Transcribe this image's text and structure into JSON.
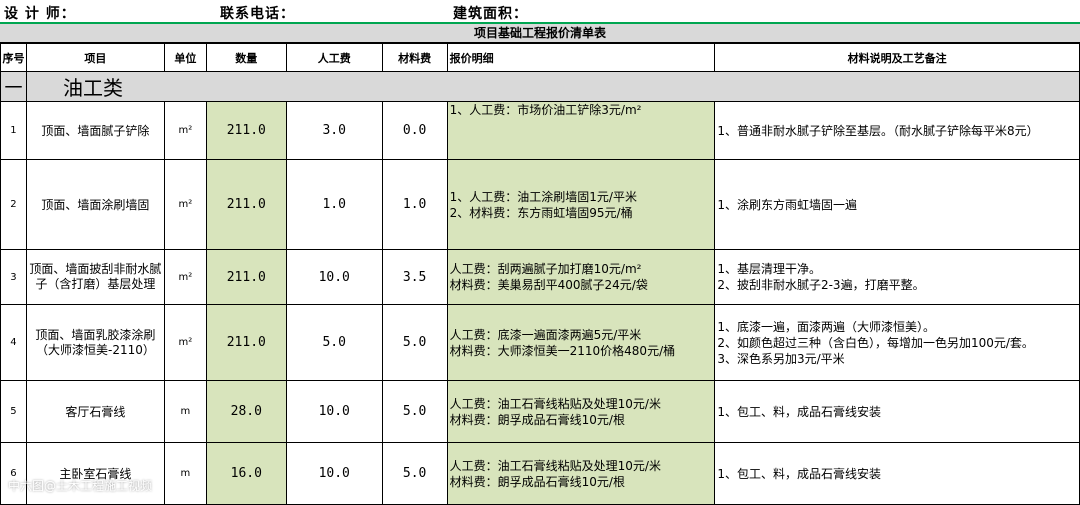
{
  "header_line": {
    "designer": "设  计  师：",
    "phone": "联系电话：",
    "area": "建筑面积："
  },
  "sheet_title": "项目基础工程报价清单表",
  "columns": [
    "序号",
    "项目",
    "单位",
    "数量",
    "人工费",
    "材料费",
    "报价明细",
    "材料说明及工艺备注"
  ],
  "section": {
    "index": "一",
    "name": "油工类"
  },
  "rows": [
    {
      "no": "1",
      "item": "顶面、墙面腻子铲除",
      "unit": "m²",
      "qty": "211.0",
      "labor": "3.0",
      "material": "0.0",
      "detail": "1、人工费：市场价油工铲除3元/m²",
      "note": "1、普通非耐水腻子铲除至基层。（耐水腻子铲除每平米8元）"
    },
    {
      "no": "2",
      "item": "顶面、墙面涂刷墙固",
      "unit": "m²",
      "qty": "211.0",
      "labor": "1.0",
      "material": "1.0",
      "detail": "1、人工费：油工涂刷墙固1元/平米\n2、材料费：东方雨虹墙固95元/桶",
      "note": "1、涂刷东方雨虹墙固一遍"
    },
    {
      "no": "3",
      "item": "顶面、墙面披刮非耐水腻子（含打磨）基层处理",
      "unit": "m²",
      "qty": "211.0",
      "labor": "10.0",
      "material": "3.5",
      "detail": "人工费：刮两遍腻子加打磨10元/m²\n材料费：美巢易刮平400腻子24元/袋",
      "note": "1、基层清理干净。\n2、披刮非耐水腻子2-3遍，打磨平整。"
    },
    {
      "no": "4",
      "item": "顶面、墙面乳胶漆涂刷（大师漆恒美-2110）",
      "unit": "m²",
      "qty": "211.0",
      "labor": "5.0",
      "material": "5.0",
      "detail": "人工费：底漆一遍面漆两遍5元/平米\n材料费：大师漆恒美一2110价格480元/桶",
      "note": "1、底漆一遍，面漆两遍（大师漆恒美）。\n2、如颜色超过三种（含白色），每增加一色另加100元/套。\n3、深色系另加3元/平米"
    },
    {
      "no": "5",
      "item": "客厅石膏线",
      "unit": "m",
      "qty": "28.0",
      "labor": "10.0",
      "material": "5.0",
      "detail": "人工费：油工石膏线粘贴及处理10元/米\n材料费：朗孚成品石膏线10元/根",
      "note": "1、包工、料，成品石膏线安装"
    },
    {
      "no": "6",
      "item": "主卧室石膏线",
      "unit": "m",
      "qty": "16.0",
      "labor": "10.0",
      "material": "5.0",
      "detail": "人工费：油工石膏线粘贴及处理10元/米\n材料费：朗孚成品石膏线10元/根",
      "note": "1、包工、料，成品石膏线安装"
    }
  ],
  "watermark": "中六图@土木工程施工视频"
}
